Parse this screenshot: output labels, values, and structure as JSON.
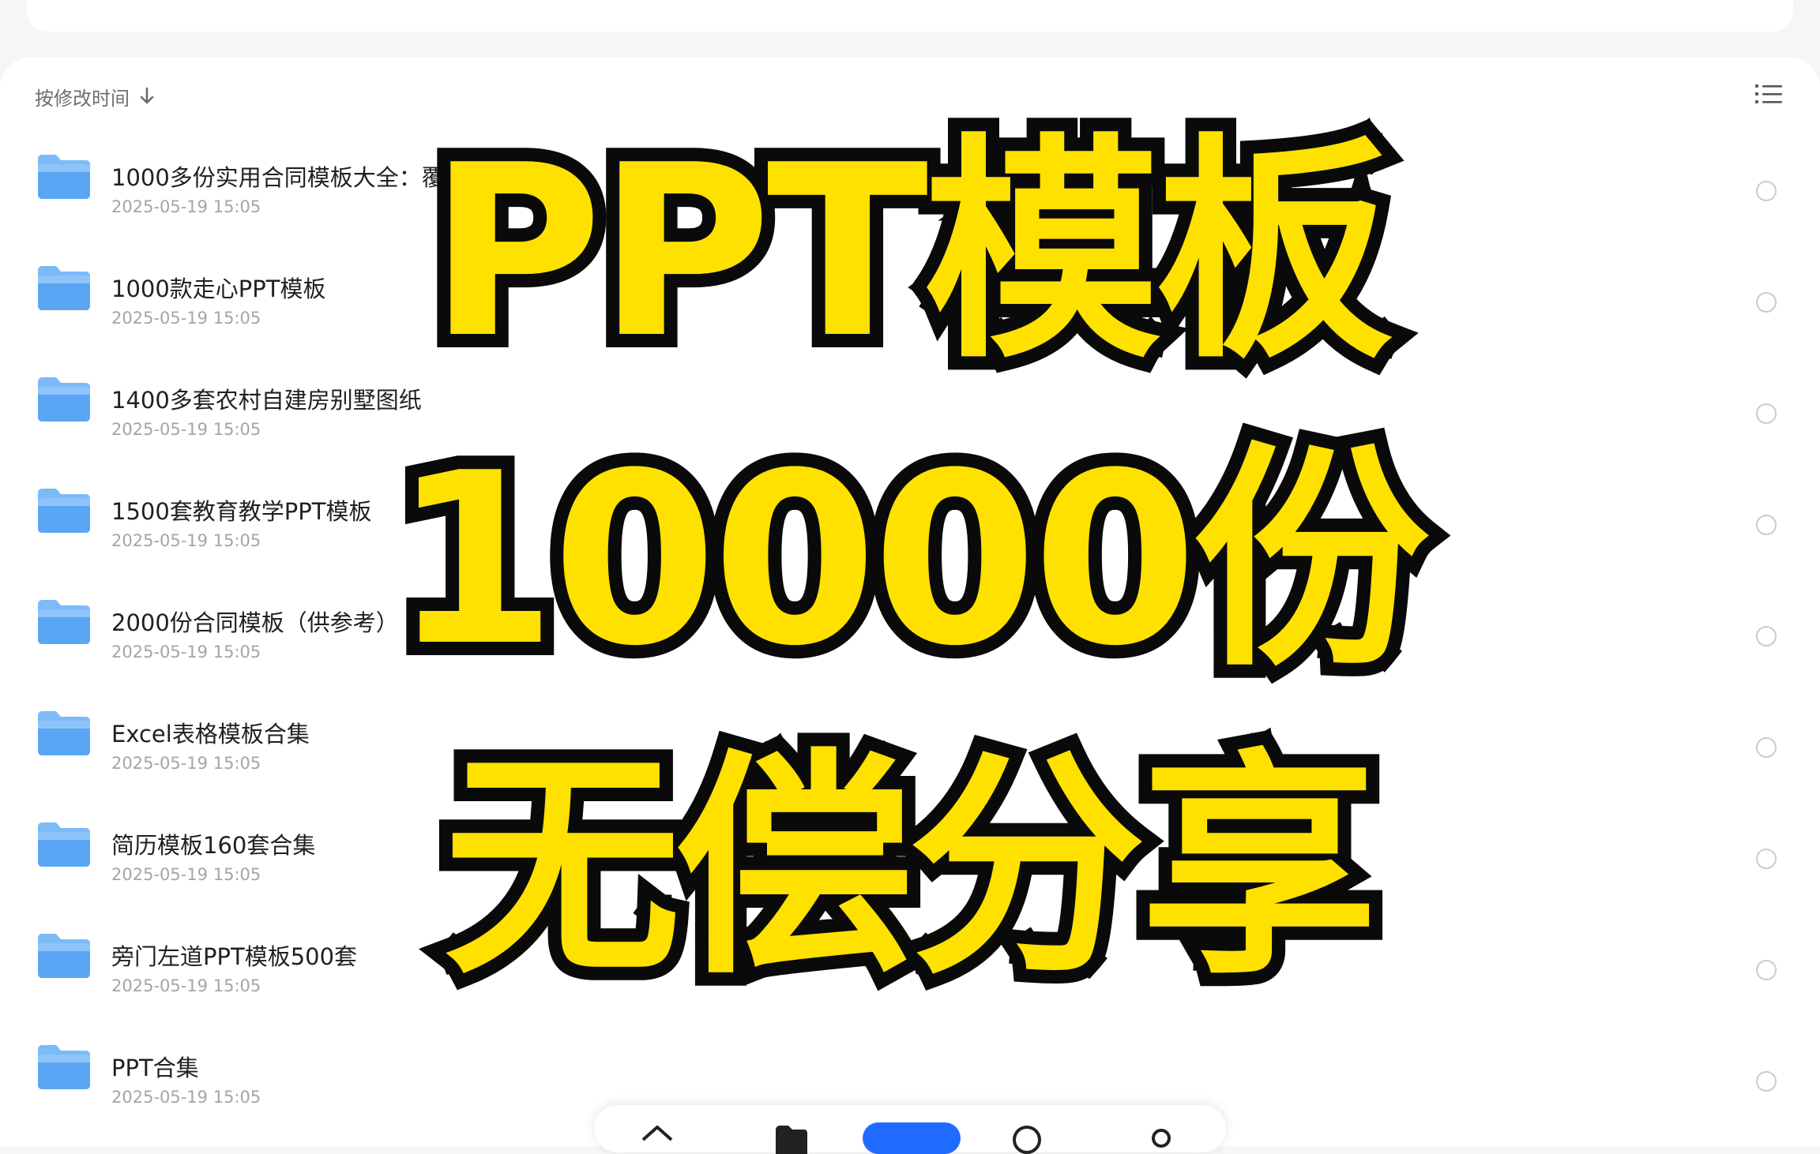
{
  "sort": {
    "label": "按修改时间",
    "icon": "arrow-down-icon"
  },
  "view_toggle": {
    "icon": "list-view-icon"
  },
  "files": [
    {
      "name": "1000多份实用合同模板大全：覆",
      "date": "2025-05-19 15:05"
    },
    {
      "name": "1000款走心PPT模板",
      "date": "2025-05-19 15:05"
    },
    {
      "name": "1400多套农村自建房别墅图纸",
      "date": "2025-05-19 15:05"
    },
    {
      "name": "1500套教育教学PPT模板",
      "date": "2025-05-19 15:05"
    },
    {
      "name": "2000份合同模板（供参考）",
      "date": "2025-05-19 15:05"
    },
    {
      "name": "Excel表格模板合集",
      "date": "2025-05-19 15:05"
    },
    {
      "name": "简历模板160套合集",
      "date": "2025-05-19 15:05"
    },
    {
      "name": "旁门左道PPT模板500套",
      "date": "2025-05-19 15:05"
    },
    {
      "name": "PPT合集",
      "date": "2025-05-19 15:05"
    }
  ],
  "overlay": {
    "line1": "PPT模板",
    "line2": "10000份",
    "line3": "无偿分享",
    "fill_color": "#ffe100",
    "stroke_color": "#0a0a0a"
  },
  "bottom_nav": {
    "items": [
      "home-icon",
      "folder-icon",
      "active-tab",
      "search-icon",
      "profile-icon"
    ],
    "active_color": "#1f6bff"
  },
  "colors": {
    "folder": "#5aa6f5",
    "folder_light": "#b9dcfb"
  }
}
